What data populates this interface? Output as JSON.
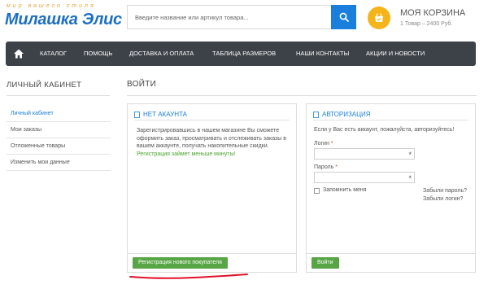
{
  "logo": {
    "tagline": "мир вашего стиля",
    "name": "Милашка Элис"
  },
  "search": {
    "placeholder": "Введите название или артикул товара...",
    "icon": "search-icon"
  },
  "cart": {
    "title": "МОЯ КОРЗИНА",
    "summary": "1 Товар – 2400 Руб.",
    "icon": "basket-icon"
  },
  "nav": {
    "home_icon": "home-icon",
    "items": [
      "КАТАЛОГ",
      "ПОМОЩЬ",
      "ДОСТАВКА И ОПЛАТА",
      "ТАБЛИЦА РАЗМЕРОВ",
      "НАШИ КОНТАКТЫ",
      "АКЦИИ И НОВОСТИ"
    ]
  },
  "sidebar": {
    "title": "ЛИЧНЫЙ КАБИНЕТ",
    "items": [
      "Личный кабинет",
      "Мои заказы",
      "Отложенные товары",
      "Изменить мои данные"
    ]
  },
  "main": {
    "title": "ВОЙТИ",
    "register": {
      "heading": "НЕТ АКАУНТА",
      "text": "Зарегистрировавшись в нашем магазине Вы сможете оформить заказ, просматривать и отслеживать заказы в вашем аккаунте, получать накопительные скидки.",
      "highlight": "Регистрация займет меньше минуты!",
      "button": "Регистрация нового покупателя"
    },
    "login": {
      "heading": "АВТОРИЗАЦИЯ",
      "intro": "Если у Вас есть аккаунт, пожалуйста, авторизуйтесь!",
      "login_label": "Логин",
      "password_label": "Пароль",
      "required_mark": "*",
      "field_mark": "*",
      "remember_label": "Запомнить меня",
      "forgot_password": "Забыли пароль?",
      "forgot_login": "Забыли логин?",
      "button": "Войти"
    }
  },
  "colors": {
    "accent": "#1a7fdc",
    "nav_bg": "#3d4248",
    "green": "#58a545",
    "cart": "#f5b41a",
    "annotation": "#e0102a"
  }
}
